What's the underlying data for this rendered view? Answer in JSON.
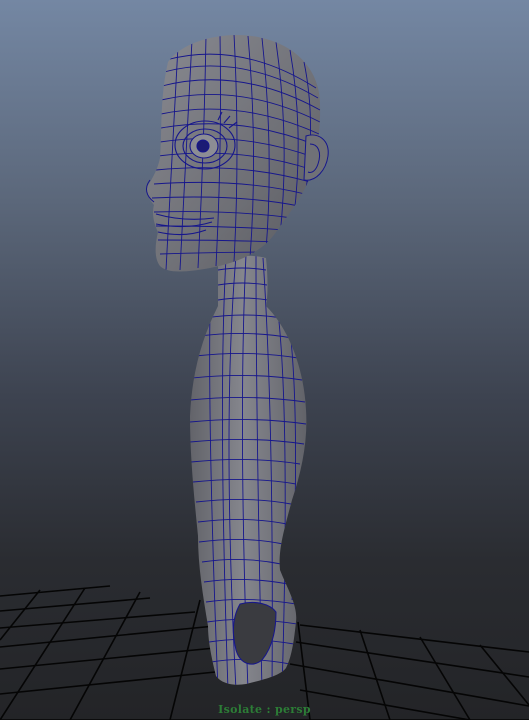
{
  "viewport": {
    "hud_label": "Isolate : persp",
    "background_top": "#7487a3",
    "background_bottom": "#232427",
    "wireframe_color": "#16168c",
    "mesh_shade": "#7f8087",
    "grid_color": "#050505"
  },
  "scene": {
    "model": "character-bust-polygon-mesh",
    "ground": "perspective-grid"
  }
}
